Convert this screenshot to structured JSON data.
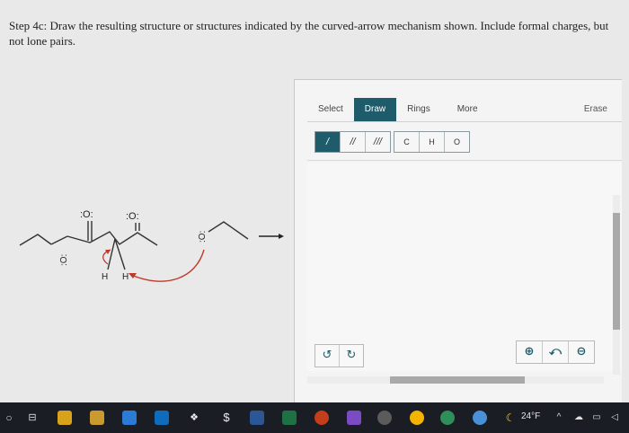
{
  "question": {
    "text": "Step 4c: Draw the resulting structure or structures indicated by the curved-arrow mechanism shown. Include formal charges, but not lone pairs."
  },
  "mechanism": {
    "carbonyl_o_left": ":O:",
    "carbonyl_o_right": ":O:",
    "ester_o": ":O:",
    "alkoxide_o": ":O:",
    "h_left": "H",
    "h_right": "H"
  },
  "editor": {
    "tabs": [
      "Select",
      "Draw",
      "Rings",
      "More"
    ],
    "active_tab": "Draw",
    "erase_label": "Erase",
    "bond_buttons": [
      "/",
      "//",
      "///"
    ],
    "atom_buttons": [
      "C",
      "H",
      "O"
    ]
  },
  "taskbar": {
    "temperature": "24°F"
  },
  "colors": {
    "accent": "#1f5c6b",
    "arrow": "#c0392b"
  }
}
